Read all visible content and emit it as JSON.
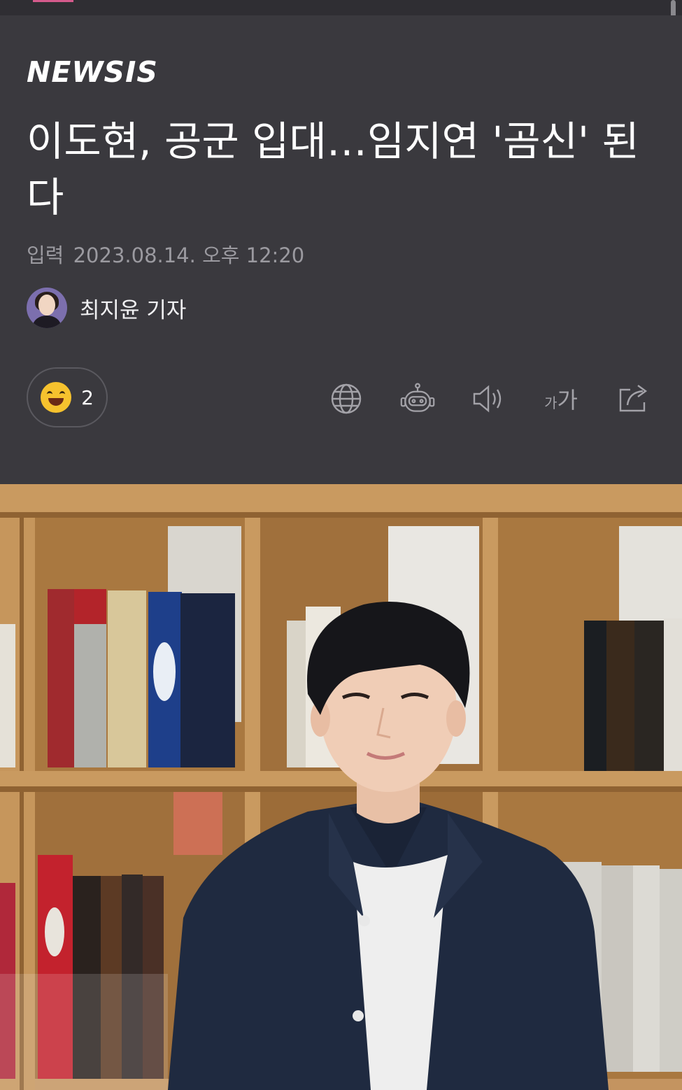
{
  "logo": "NEWSIS",
  "headline": "이도현, 공군 입대…임지연 '곰신' 된다",
  "dateline": {
    "label": "입력",
    "value": "2023.08.14. 오후 12:20"
  },
  "author": {
    "name": "최지윤 기자"
  },
  "reaction": {
    "count": "2",
    "icon": "laughing-emoji-icon"
  },
  "tools": [
    {
      "name": "translate",
      "icon": "globe-icon"
    },
    {
      "name": "summary-bot",
      "icon": "robot-icon"
    },
    {
      "name": "text-to-speech",
      "icon": "speaker-icon"
    },
    {
      "name": "font-size",
      "icon": "font-size-icon",
      "label_small": "가",
      "label_large": "가"
    },
    {
      "name": "share",
      "icon": "share-icon"
    }
  ],
  "colors": {
    "background": "#3a393e",
    "secondary_text": "#9b9aa0",
    "icon": "#a3a2a8",
    "tab_indicator": "#d45a8c"
  }
}
